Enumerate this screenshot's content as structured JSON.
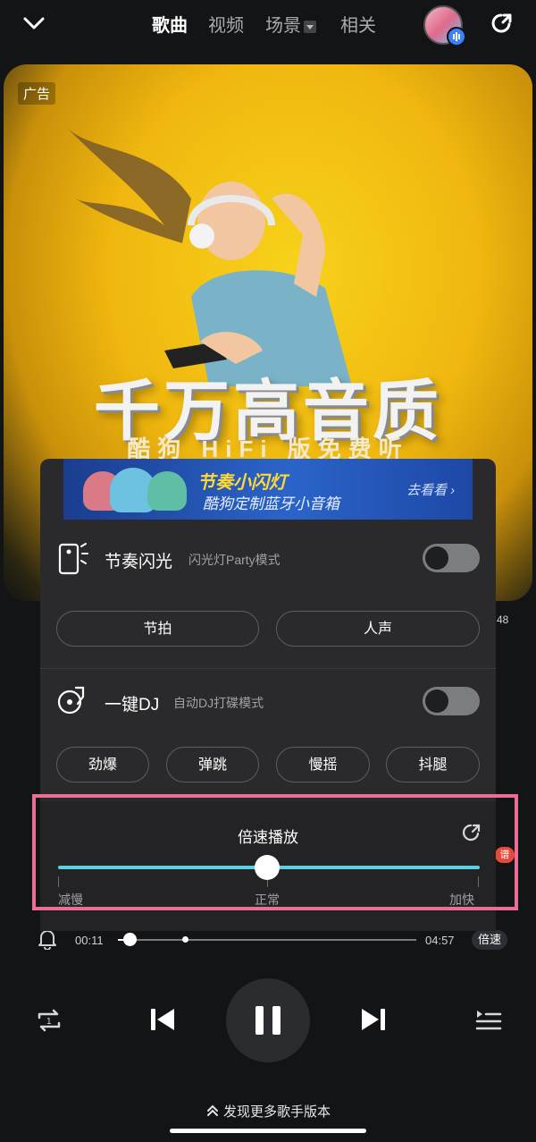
{
  "nav": {
    "tabs": [
      {
        "label": "歌曲"
      },
      {
        "label": "视频"
      },
      {
        "label": "场景"
      },
      {
        "label": "相关"
      }
    ]
  },
  "ad": {
    "tag": "广告",
    "headline": "千万高音质",
    "subline": "酷狗 HiFi 版免费听"
  },
  "panel": {
    "banner": {
      "title": "节奏小闪灯",
      "subtitle": "酷狗定制蓝牙小音箱",
      "cta": "去看看 ›"
    },
    "flash": {
      "title": "节奏闪光",
      "desc": "闪光灯Party模式",
      "options": [
        "节拍",
        "人声"
      ],
      "enabled": false
    },
    "dj": {
      "title": "一键DJ",
      "desc": "自动DJ打碟模式",
      "options": [
        "劲爆",
        "弹跳",
        "慢摇",
        "抖腿"
      ],
      "enabled": false
    },
    "speed": {
      "title": "倍速播放",
      "labels": {
        "slow": "减慢",
        "normal": "正常",
        "fast": "加快"
      }
    }
  },
  "player": {
    "elapsed": "00:11",
    "duration": "04:57",
    "speed_label": "倍速",
    "progress_fraction": 0.04,
    "more_versions": "发现更多歌手版本",
    "side_number": "48",
    "side_badge": "谱"
  },
  "colors": {
    "accent": "#5cd0e3",
    "highlight": "#ec6d96",
    "ad_yellow": "#f0b70f"
  }
}
